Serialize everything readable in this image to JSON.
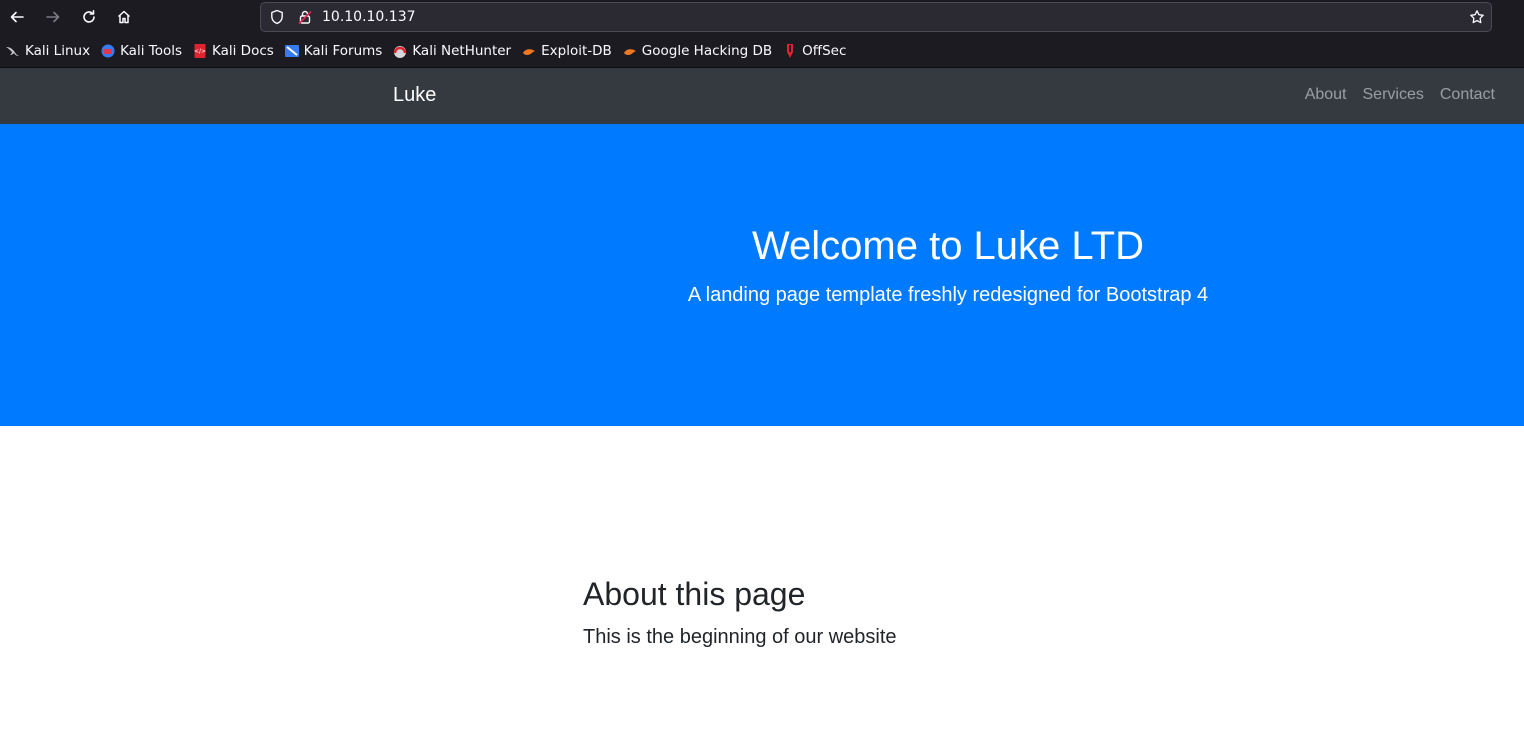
{
  "browser": {
    "url": "10.10.10.137",
    "bookmarks": [
      {
        "label": "Kali Linux",
        "icon": "kali-dragon-icon"
      },
      {
        "label": "Kali Tools",
        "icon": "kali-tools-icon"
      },
      {
        "label": "Kali Docs",
        "icon": "kali-docs-icon"
      },
      {
        "label": "Kali Forums",
        "icon": "kali-forums-icon"
      },
      {
        "label": "Kali NetHunter",
        "icon": "kali-nethunter-icon"
      },
      {
        "label": "Exploit-DB",
        "icon": "exploit-db-icon"
      },
      {
        "label": "Google Hacking DB",
        "icon": "ghdb-icon"
      },
      {
        "label": "OffSec",
        "icon": "offsec-icon"
      }
    ]
  },
  "navbar": {
    "brand": "Luke",
    "links": [
      "About",
      "Services",
      "Contact"
    ]
  },
  "hero": {
    "title": "Welcome to Luke LTD",
    "lead": "A landing page template freshly redesigned for Bootstrap 4"
  },
  "about": {
    "title": "About this page",
    "lead": "This is the beginning of our website"
  },
  "colors": {
    "navbar": "#343a40",
    "hero": "#007bff",
    "browser_chrome": "#1c1b22"
  }
}
